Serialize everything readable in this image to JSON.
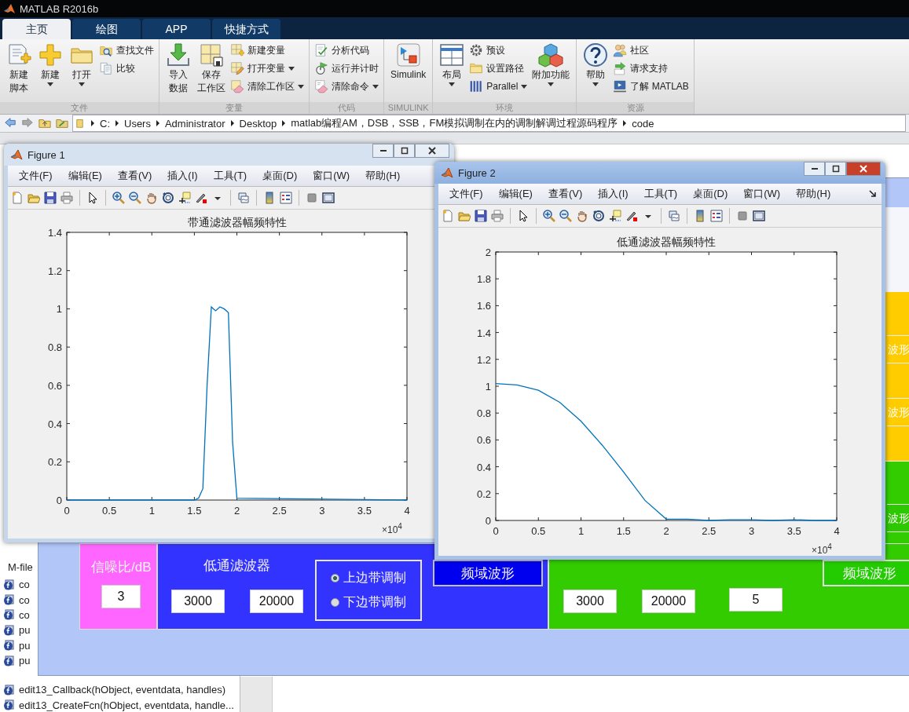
{
  "window": {
    "title": "MATLAB R2016b"
  },
  "tabs": [
    {
      "label": "主页",
      "selected": true
    },
    {
      "label": "绘图",
      "selected": false
    },
    {
      "label": "APP",
      "selected": false
    },
    {
      "label": "快捷方式",
      "selected": false
    }
  ],
  "ribbon": {
    "groups": [
      {
        "title": "文件",
        "items": [
          {
            "kind": "large",
            "lines": [
              "新建",
              "脚本"
            ],
            "dropdown": false
          },
          {
            "kind": "large",
            "lines": [
              "新建"
            ],
            "dropdown": true
          },
          {
            "kind": "large",
            "lines": [
              "打开"
            ],
            "dropdown": true
          },
          {
            "kind": "small",
            "label": "查找文件",
            "dropdown": false
          },
          {
            "kind": "small",
            "label": "比较",
            "dropdown": false
          }
        ]
      },
      {
        "title": "变量",
        "items": [
          {
            "kind": "large",
            "lines": [
              "导入",
              "数据"
            ],
            "dropdown": false
          },
          {
            "kind": "large",
            "lines": [
              "保存",
              "工作区"
            ],
            "dropdown": false
          },
          {
            "kind": "small",
            "label": "新建变量",
            "dropdown": false
          },
          {
            "kind": "small",
            "label": "打开变量",
            "dropdown": true
          },
          {
            "kind": "small",
            "label": "清除工作区",
            "dropdown": true
          }
        ]
      },
      {
        "title": "代码",
        "items": [
          {
            "kind": "small",
            "label": "分析代码",
            "dropdown": false
          },
          {
            "kind": "small",
            "label": "运行并计时",
            "dropdown": false
          },
          {
            "kind": "small",
            "label": "清除命令",
            "dropdown": true
          }
        ]
      },
      {
        "title": "SIMULINK",
        "items": [
          {
            "kind": "large",
            "lines": [
              "Simulink"
            ],
            "dropdown": false
          }
        ]
      },
      {
        "title": "环境",
        "items": [
          {
            "kind": "large",
            "lines": [
              "布局"
            ],
            "dropdown": true
          },
          {
            "kind": "small",
            "label": "预设",
            "dropdown": false
          },
          {
            "kind": "small",
            "label": "设置路径",
            "dropdown": false
          },
          {
            "kind": "small",
            "label": "Parallel",
            "dropdown": true
          },
          {
            "kind": "large",
            "lines": [
              "附加功能"
            ],
            "dropdown": true
          }
        ]
      },
      {
        "title": "资源",
        "items": [
          {
            "kind": "large",
            "lines": [
              "帮助"
            ],
            "dropdown": true
          },
          {
            "kind": "small",
            "label": "社区",
            "dropdown": false
          },
          {
            "kind": "small",
            "label": "请求支持",
            "dropdown": false
          },
          {
            "kind": "small",
            "label": "了解 MATLAB",
            "dropdown": false
          }
        ]
      }
    ]
  },
  "address_bar": {
    "segments": [
      "C:",
      "Users",
      "Administrator",
      "Desktop",
      "matlab编程AM，DSB，SSB，FM模拟调制在内的调制解调过程源码程序",
      "code"
    ]
  },
  "file_browser": {
    "header": "M-file",
    "items": [
      "co",
      "co",
      "co",
      "pu",
      "pu",
      "pu"
    ],
    "bottom_items": [
      "edit13_Callback(hObject, eventdata, handles)",
      "edit13_CreateFcn(hObject, eventdata, handle..."
    ]
  },
  "gui": {
    "snr_panel": {
      "label": "信噪比/dB",
      "value": "3"
    },
    "lowpass_panel": {
      "label": "低通滤波器",
      "fields": [
        "3000",
        "20000"
      ],
      "modulation": [
        {
          "label": "上边带调制",
          "selected": true
        },
        {
          "label": "下边带调制",
          "selected": false
        }
      ],
      "button": "频域波形"
    },
    "highpass_panel": {
      "fields": [
        "3000",
        "20000",
        "5"
      ],
      "button": "频域波形"
    },
    "side_buttons": [
      {
        "label": "波形",
        "kind": "yellow"
      },
      {
        "label": "波形",
        "kind": "yellow"
      },
      {
        "label": "波形",
        "kind": "green"
      }
    ]
  },
  "figures": [
    {
      "title": "Figure 1",
      "active": false,
      "menu": [
        "文件(F)",
        "编辑(E)",
        "查看(V)",
        "插入(I)",
        "工具(T)",
        "桌面(D)",
        "窗口(W)",
        "帮助(H)"
      ],
      "x_multiplier": "×10$^{4}$",
      "chart_data": {
        "type": "line",
        "title": "带通滤波器幅频特性",
        "x": [
          0,
          1.5,
          1.55,
          1.6,
          1.65,
          1.7,
          1.75,
          1.8,
          1.85,
          1.9,
          1.95,
          2,
          4
        ],
        "series": [
          {
            "color": "#0072bd",
            "values": [
              0,
              0,
              0.01,
              0.06,
              0.6,
              1.01,
              0.99,
              1.01,
              1.0,
              0.98,
              0.3,
              0.01,
              0
            ]
          }
        ],
        "xlim": [
          0,
          4
        ],
        "ylim": [
          0,
          1.4
        ],
        "xticks": [
          0,
          0.5,
          1,
          1.5,
          2,
          2.5,
          3,
          3.5,
          4
        ],
        "yticks": [
          0,
          0.2,
          0.4,
          0.6,
          0.8,
          1,
          1.2,
          1.4
        ]
      }
    },
    {
      "title": "Figure 2",
      "active": true,
      "dock_arrow": true,
      "menu": [
        "文件(F)",
        "编辑(E)",
        "查看(V)",
        "插入(I)",
        "工具(T)",
        "桌面(D)",
        "窗口(W)",
        "帮助(H)"
      ],
      "x_multiplier": "×10$^{4}$",
      "chart_data": {
        "type": "line",
        "title": "低通滤波器幅频特性",
        "x": [
          0,
          0.25,
          0.5,
          0.75,
          1,
          1.25,
          1.5,
          1.75,
          2,
          2.25,
          2.5,
          2.75,
          3,
          3.25,
          3.5,
          3.75,
          4
        ],
        "series": [
          {
            "color": "#0072bd",
            "values": [
              1.02,
              1.01,
              0.97,
              0.88,
              0.74,
              0.56,
              0.36,
              0.15,
              0.01,
              0.01,
              0,
              0.005,
              0.005,
              0,
              0.005,
              0,
              0
            ]
          }
        ],
        "xlim": [
          0,
          4
        ],
        "ylim": [
          0,
          2
        ],
        "xticks": [
          0,
          0.5,
          1,
          1.5,
          2,
          2.5,
          3,
          3.5,
          4
        ],
        "yticks": [
          0,
          0.2,
          0.4,
          0.6,
          0.8,
          1,
          1.2,
          1.4,
          1.6,
          1.8,
          2
        ]
      }
    }
  ]
}
